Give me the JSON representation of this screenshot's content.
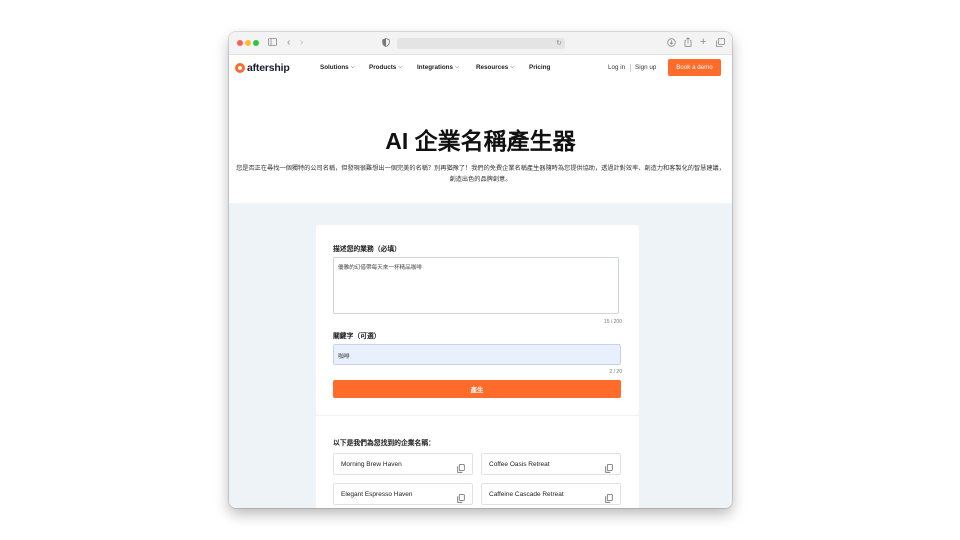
{
  "colors": {
    "brand": "#ff6b2b",
    "section_bg": "#eef3f8",
    "input_bg": "#e8f0fe"
  },
  "browser": {
    "icons": [
      "sidebar-icon",
      "back-icon",
      "forward-icon",
      "shield-icon",
      "reload-icon",
      "download-icon",
      "share-icon",
      "new-tab-icon",
      "tabs-icon"
    ]
  },
  "nav": {
    "logo_text": "aftership",
    "items": [
      "Solutions",
      "Products",
      "Integrations",
      "Resources",
      "Pricing"
    ],
    "login": "Log in",
    "signup": "Sign up",
    "cta": "Book a demo"
  },
  "hero": {
    "title": "AI 企業名稱產生器",
    "description": "您是否正在尋找一個獨特的公司名稱，但發現很難想出一個完美的名稱？別再猶豫了！我們的免費企業名稱產生器隨時為您提供協助，透過計對效率、創造力和客製化的智慧建議，創造出色的品牌創意。"
  },
  "form": {
    "business_label": "描述您的業務（必填）",
    "business_value": "優雅的幻借帶每天來一杯精品咖啡",
    "business_counter": "15 / 200",
    "keywords_label": "關鍵字（可選）",
    "keywords_value": "咖啡",
    "keywords_counter": "2 / 20",
    "generate_label": "產生"
  },
  "results": {
    "heading": "以下是我們為您找到的企業名稱：",
    "names": [
      "Morning Brew Haven",
      "Coffee Oasis Retreat",
      "Elegant Espresso Haven",
      "Caffeine Cascade Retreat"
    ]
  }
}
